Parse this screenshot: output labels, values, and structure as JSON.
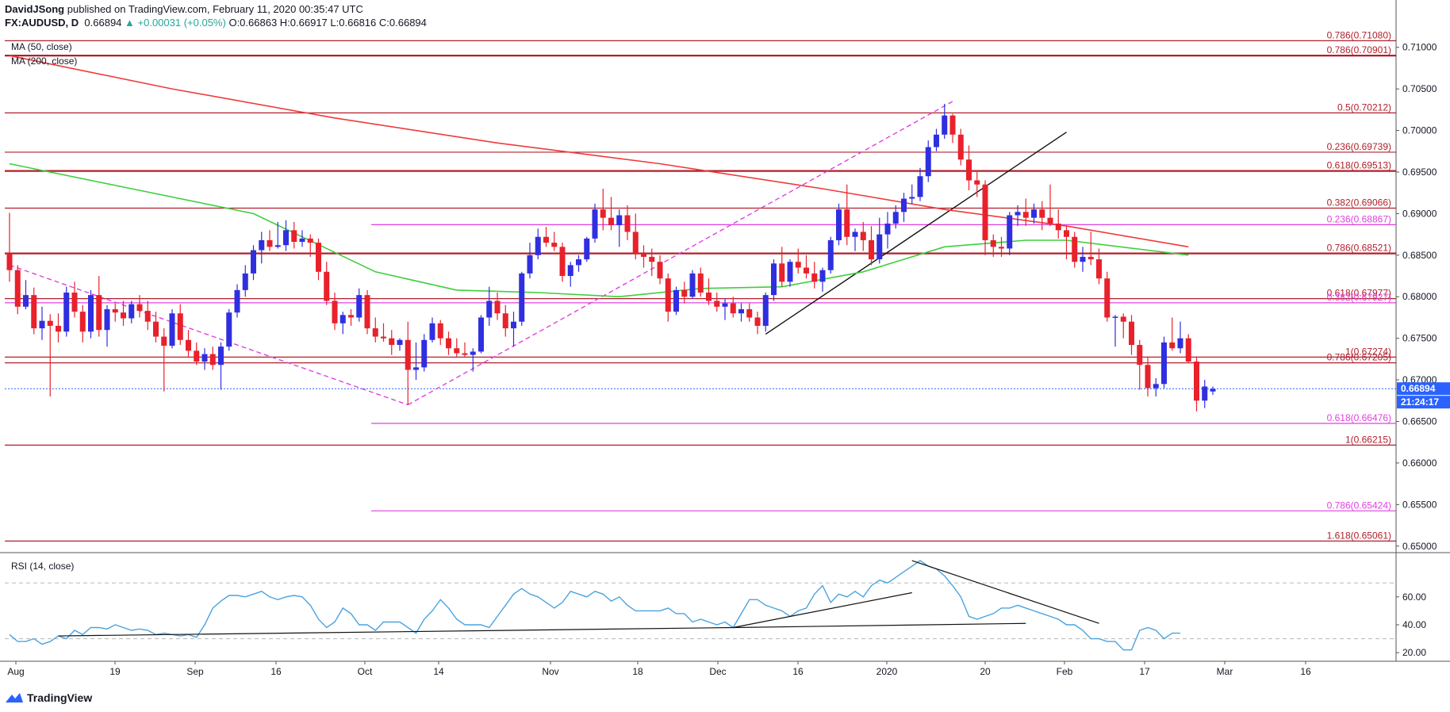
{
  "header": {
    "author": "DavidJSong",
    "published": "published on TradingView.com, February 11, 2020 00:35:47 UTC",
    "symbol": "FX:AUDUSD, D",
    "last": "0.66894",
    "change": "▲ +0.00031 (+0.05%)",
    "open": "O:0.66863",
    "high": "H:0.66917",
    "low": "L:0.66816",
    "close": "C:0.66894"
  },
  "footer": {
    "brand": "TradingView"
  },
  "colors": {
    "up": "#2f2fe0",
    "down": "#e8212b",
    "ma50": "#3ecf3e",
    "ma200": "#ef3b3b",
    "fib_red": "#b0202c",
    "fib_magenta": "#e040e0",
    "rsi": "#4aa3e0",
    "trend": "#111111",
    "axis_text": "#131722",
    "price_label": "#2962ff",
    "grid": "#b8b8b8"
  },
  "chart_data": {
    "type": "candlestick",
    "symbol": "FX:AUDUSD",
    "timeframe": "D",
    "legend": [
      "MA (50, close)",
      "MA (200, close)"
    ],
    "ylim": [
      0.6495,
      0.7115
    ],
    "y_ticks": [
      "0.71000",
      "0.70500",
      "0.70000",
      "0.69500",
      "0.69000",
      "0.68500",
      "0.68000",
      "0.67500",
      "0.67000",
      "0.66500",
      "0.66000",
      "0.65500",
      "0.65000"
    ],
    "x_ticks": [
      "Aug",
      "19",
      "Sep",
      "16",
      "Oct",
      "14",
      "Nov",
      "18",
      "Dec",
      "16",
      "2020",
      "20",
      "Feb",
      "17",
      "Mar",
      "16"
    ],
    "last_price": {
      "label": "0.66894",
      "value": 0.66894,
      "countdown": "21:24:17"
    },
    "fib_levels": [
      {
        "label": "0.786(0.71080)",
        "value": 0.7108,
        "color": "red"
      },
      {
        "label": "0.786(0.70901)",
        "value": 0.70901,
        "color": "red",
        "thick": true
      },
      {
        "label": "0.5(0.70212)",
        "value": 0.70212,
        "color": "red"
      },
      {
        "label": "0.236(0.69739)",
        "value": 0.69739,
        "color": "red"
      },
      {
        "label": "0.618(0.69513)",
        "value": 0.69513,
        "color": "red",
        "thick": true
      },
      {
        "label": "0.382(0.69066)",
        "value": 0.69066,
        "color": "red"
      },
      {
        "label": "0.236(0.68867)",
        "value": 0.68867,
        "color": "magenta",
        "from": "Oct"
      },
      {
        "label": "0.786(0.68521)",
        "value": 0.68521,
        "color": "red",
        "thick": true
      },
      {
        "label": "0.618(0.67977)",
        "value": 0.67977,
        "color": "red"
      },
      {
        "label": "0.382(0.67927)",
        "value": 0.67927,
        "color": "magenta"
      },
      {
        "label": "1(0.67274)",
        "value": 0.67274,
        "color": "red"
      },
      {
        "label": "0.786(0.67205)",
        "value": 0.67205,
        "color": "red"
      },
      {
        "label": "0.618(0.66476)",
        "value": 0.66476,
        "color": "magenta",
        "from": "Oct"
      },
      {
        "label": "1(0.66215)",
        "value": 0.66215,
        "color": "red"
      },
      {
        "label": "0.786(0.65424)",
        "value": 0.65424,
        "color": "magenta",
        "from": "Oct"
      },
      {
        "label": "1.618(0.65061)",
        "value": 0.65061,
        "color": "red"
      }
    ],
    "candles_ohlc": [
      [
        0.6852,
        0.6901,
        0.6818,
        0.6832
      ],
      [
        0.6832,
        0.6838,
        0.6779,
        0.6788
      ],
      [
        0.6788,
        0.682,
        0.6785,
        0.6802
      ],
      [
        0.6802,
        0.6811,
        0.6755,
        0.6762
      ],
      [
        0.6762,
        0.6788,
        0.6748,
        0.6771
      ],
      [
        0.6771,
        0.6779,
        0.668,
        0.6765
      ],
      [
        0.6765,
        0.678,
        0.6745,
        0.6758
      ],
      [
        0.6758,
        0.6812,
        0.6752,
        0.6805
      ],
      [
        0.6805,
        0.6818,
        0.6775,
        0.6782
      ],
      [
        0.6782,
        0.679,
        0.6745,
        0.6758
      ],
      [
        0.6758,
        0.6808,
        0.675,
        0.6802
      ],
      [
        0.6802,
        0.6825,
        0.6752,
        0.676
      ],
      [
        0.676,
        0.679,
        0.674,
        0.6785
      ],
      [
        0.6785,
        0.6792,
        0.677,
        0.6781
      ],
      [
        0.6781,
        0.6795,
        0.6765,
        0.6774
      ],
      [
        0.6774,
        0.6795,
        0.6768,
        0.6791
      ],
      [
        0.6791,
        0.6802,
        0.6775,
        0.6783
      ],
      [
        0.6783,
        0.6795,
        0.676,
        0.677
      ],
      [
        0.677,
        0.6782,
        0.6745,
        0.6752
      ],
      [
        0.6752,
        0.6762,
        0.6686,
        0.6741
      ],
      [
        0.6741,
        0.6785,
        0.6738,
        0.678
      ],
      [
        0.678,
        0.6791,
        0.6742,
        0.6748
      ],
      [
        0.6748,
        0.676,
        0.6728,
        0.6735
      ],
      [
        0.6735,
        0.6745,
        0.6718,
        0.6722
      ],
      [
        0.6722,
        0.6738,
        0.6712,
        0.6731
      ],
      [
        0.6731,
        0.674,
        0.6712,
        0.6718
      ],
      [
        0.6718,
        0.6745,
        0.6688,
        0.674
      ],
      [
        0.674,
        0.6785,
        0.6735,
        0.6781
      ],
      [
        0.6781,
        0.6815,
        0.6775,
        0.6808
      ],
      [
        0.6808,
        0.6838,
        0.68,
        0.6828
      ],
      [
        0.6828,
        0.6862,
        0.682,
        0.6856
      ],
      [
        0.6856,
        0.6878,
        0.684,
        0.6868
      ],
      [
        0.6868,
        0.688,
        0.6855,
        0.686
      ],
      [
        0.686,
        0.689,
        0.6858,
        0.6862
      ],
      [
        0.6862,
        0.6892,
        0.6855,
        0.688
      ],
      [
        0.688,
        0.689,
        0.6858,
        0.6866
      ],
      [
        0.6866,
        0.688,
        0.686,
        0.687
      ],
      [
        0.687,
        0.6875,
        0.6848,
        0.6865
      ],
      [
        0.6865,
        0.687,
        0.682,
        0.683
      ],
      [
        0.683,
        0.6842,
        0.679,
        0.6795
      ],
      [
        0.6795,
        0.6805,
        0.676,
        0.6768
      ],
      [
        0.6768,
        0.6782,
        0.6755,
        0.6778
      ],
      [
        0.6778,
        0.6785,
        0.6765,
        0.6775
      ],
      [
        0.6775,
        0.681,
        0.677,
        0.6802
      ],
      [
        0.6802,
        0.6808,
        0.6755,
        0.6762
      ],
      [
        0.6762,
        0.6775,
        0.6745,
        0.6752
      ],
      [
        0.6752,
        0.6768,
        0.6746,
        0.675
      ],
      [
        0.675,
        0.676,
        0.673,
        0.6742
      ],
      [
        0.6742,
        0.675,
        0.6735,
        0.6748
      ],
      [
        0.6748,
        0.677,
        0.667,
        0.6712
      ],
      [
        0.6712,
        0.6745,
        0.67,
        0.6715
      ],
      [
        0.6715,
        0.6755,
        0.671,
        0.6748
      ],
      [
        0.6748,
        0.6775,
        0.6745,
        0.6768
      ],
      [
        0.6768,
        0.6772,
        0.6742,
        0.675
      ],
      [
        0.675,
        0.6758,
        0.673,
        0.6738
      ],
      [
        0.6738,
        0.675,
        0.6728,
        0.6732
      ],
      [
        0.6732,
        0.6745,
        0.6728,
        0.673
      ],
      [
        0.673,
        0.6738,
        0.671,
        0.6734
      ],
      [
        0.6734,
        0.6778,
        0.6732,
        0.6775
      ],
      [
        0.6775,
        0.6812,
        0.6765,
        0.6795
      ],
      [
        0.6795,
        0.6805,
        0.6772,
        0.678
      ],
      [
        0.678,
        0.679,
        0.6752,
        0.6762
      ],
      [
        0.6762,
        0.6782,
        0.674,
        0.677
      ],
      [
        0.677,
        0.683,
        0.6765,
        0.6828
      ],
      [
        0.6828,
        0.6865,
        0.6822,
        0.685
      ],
      [
        0.685,
        0.6882,
        0.6845,
        0.6872
      ],
      [
        0.6872,
        0.6884,
        0.686,
        0.6865
      ],
      [
        0.6865,
        0.6878,
        0.6855,
        0.686
      ],
      [
        0.686,
        0.6865,
        0.6818,
        0.6825
      ],
      [
        0.6825,
        0.6842,
        0.6812,
        0.6838
      ],
      [
        0.6838,
        0.685,
        0.683,
        0.6845
      ],
      [
        0.6845,
        0.6872,
        0.6842,
        0.687
      ],
      [
        0.687,
        0.6912,
        0.6865,
        0.6905
      ],
      [
        0.6905,
        0.693,
        0.688,
        0.6895
      ],
      [
        0.6895,
        0.692,
        0.688,
        0.6886
      ],
      [
        0.6886,
        0.6905,
        0.686,
        0.6898
      ],
      [
        0.6898,
        0.691,
        0.6868,
        0.6878
      ],
      [
        0.6878,
        0.69,
        0.6845,
        0.6852
      ],
      [
        0.6852,
        0.6862,
        0.6835,
        0.6848
      ],
      [
        0.6848,
        0.6858,
        0.6825,
        0.6842
      ],
      [
        0.6842,
        0.685,
        0.6815,
        0.6822
      ],
      [
        0.6822,
        0.6828,
        0.677,
        0.6782
      ],
      [
        0.6782,
        0.6812,
        0.6778,
        0.6808
      ],
      [
        0.6808,
        0.6818,
        0.6792,
        0.68
      ],
      [
        0.68,
        0.6832,
        0.6798,
        0.6828
      ],
      [
        0.6828,
        0.6835,
        0.68,
        0.6805
      ],
      [
        0.6805,
        0.6822,
        0.679,
        0.6795
      ],
      [
        0.6795,
        0.6805,
        0.6782,
        0.6788
      ],
      [
        0.6788,
        0.6798,
        0.6772,
        0.6792
      ],
      [
        0.6792,
        0.68,
        0.6775,
        0.678
      ],
      [
        0.678,
        0.6792,
        0.677,
        0.6785
      ],
      [
        0.6785,
        0.6792,
        0.677,
        0.6775
      ],
      [
        0.6775,
        0.6782,
        0.6755,
        0.6765
      ],
      [
        0.6765,
        0.6805,
        0.6758,
        0.6802
      ],
      [
        0.6802,
        0.6845,
        0.6795,
        0.684
      ],
      [
        0.684,
        0.686,
        0.6812,
        0.6818
      ],
      [
        0.6818,
        0.6845,
        0.6812,
        0.6842
      ],
      [
        0.6842,
        0.6858,
        0.6828,
        0.6835
      ],
      [
        0.6835,
        0.685,
        0.6822,
        0.6828
      ],
      [
        0.6828,
        0.6842,
        0.681,
        0.6818
      ],
      [
        0.6818,
        0.6835,
        0.6806,
        0.6832
      ],
      [
        0.6832,
        0.6872,
        0.6828,
        0.6868
      ],
      [
        0.6868,
        0.6912,
        0.6862,
        0.6905
      ],
      [
        0.6905,
        0.6935,
        0.6862,
        0.6872
      ],
      [
        0.6872,
        0.6882,
        0.6855,
        0.6878
      ],
      [
        0.6878,
        0.689,
        0.6855,
        0.6868
      ],
      [
        0.6868,
        0.6885,
        0.6838,
        0.6845
      ],
      [
        0.6845,
        0.6895,
        0.684,
        0.6875
      ],
      [
        0.6875,
        0.6902,
        0.6858,
        0.6888
      ],
      [
        0.6888,
        0.691,
        0.6882,
        0.6902
      ],
      [
        0.6902,
        0.6925,
        0.689,
        0.6918
      ],
      [
        0.6918,
        0.6935,
        0.6912,
        0.692
      ],
      [
        0.692,
        0.6955,
        0.6915,
        0.6945
      ],
      [
        0.6945,
        0.6988,
        0.6938,
        0.698
      ],
      [
        0.698,
        0.7002,
        0.6975,
        0.6995
      ],
      [
        0.6995,
        0.7032,
        0.699,
        0.7018
      ],
      [
        0.7018,
        0.702,
        0.6985,
        0.6995
      ],
      [
        0.6995,
        0.7002,
        0.6958,
        0.6965
      ],
      [
        0.6965,
        0.6982,
        0.6928,
        0.694
      ],
      [
        0.694,
        0.695,
        0.692,
        0.6935
      ],
      [
        0.6935,
        0.694,
        0.685,
        0.6868
      ],
      [
        0.6868,
        0.6875,
        0.6848,
        0.686
      ],
      [
        0.686,
        0.6872,
        0.6848,
        0.6858
      ],
      [
        0.6858,
        0.6902,
        0.685,
        0.6898
      ],
      [
        0.6898,
        0.691,
        0.6885,
        0.6902
      ],
      [
        0.6902,
        0.6918,
        0.6885,
        0.6895
      ],
      [
        0.6895,
        0.6912,
        0.6888,
        0.6905
      ],
      [
        0.6905,
        0.6915,
        0.688,
        0.6895
      ],
      [
        0.6895,
        0.6935,
        0.6885,
        0.6888
      ],
      [
        0.6888,
        0.6905,
        0.687,
        0.688
      ],
      [
        0.688,
        0.6885,
        0.6845,
        0.6872
      ],
      [
        0.6872,
        0.6878,
        0.6835,
        0.6842
      ],
      [
        0.6842,
        0.686,
        0.683,
        0.6848
      ],
      [
        0.6848,
        0.6878,
        0.6838,
        0.6845
      ],
      [
        0.6845,
        0.6858,
        0.6815,
        0.6822
      ],
      [
        0.6822,
        0.683,
        0.677,
        0.6775
      ],
      [
        0.6775,
        0.6778,
        0.674,
        0.6776
      ],
      [
        0.6776,
        0.678,
        0.675,
        0.677
      ],
      [
        0.677,
        0.6778,
        0.673,
        0.6742
      ],
      [
        0.6742,
        0.6748,
        0.6688,
        0.6718
      ],
      [
        0.6718,
        0.6728,
        0.668,
        0.669
      ],
      [
        0.669,
        0.6702,
        0.668,
        0.6695
      ],
      [
        0.6695,
        0.6752,
        0.669,
        0.6745
      ],
      [
        0.6745,
        0.6775,
        0.6735,
        0.6738
      ],
      [
        0.6738,
        0.677,
        0.6732,
        0.675
      ],
      [
        0.675,
        0.6755,
        0.672,
        0.6722
      ],
      [
        0.6722,
        0.6728,
        0.6662,
        0.6675
      ],
      [
        0.6675,
        0.67,
        0.6666,
        0.6692
      ],
      [
        0.6686,
        0.6692,
        0.6682,
        0.6689
      ]
    ],
    "ma50": [
      [
        0,
        0.696
      ],
      [
        15,
        0.693
      ],
      [
        30,
        0.69
      ],
      [
        45,
        0.683
      ],
      [
        55,
        0.6808
      ],
      [
        65,
        0.6805
      ],
      [
        75,
        0.68
      ],
      [
        85,
        0.681
      ],
      [
        95,
        0.6812
      ],
      [
        105,
        0.683
      ],
      [
        115,
        0.686
      ],
      [
        125,
        0.6868
      ],
      [
        130,
        0.6868
      ],
      [
        140,
        0.6856
      ],
      [
        145,
        0.685
      ]
    ],
    "ma200": [
      [
        0,
        0.709
      ],
      [
        20,
        0.705
      ],
      [
        40,
        0.7015
      ],
      [
        60,
        0.6985
      ],
      [
        80,
        0.696
      ],
      [
        100,
        0.693
      ],
      [
        115,
        0.6905
      ],
      [
        130,
        0.6885
      ],
      [
        145,
        0.686
      ]
    ],
    "rsi": {
      "label": "RSI (14, close)",
      "ylim": [
        15,
        90
      ],
      "y_ticks": [
        "60.00",
        "40.00",
        "20.00"
      ],
      "bands": [
        70,
        30
      ],
      "values": [
        33,
        28,
        28,
        30,
        26,
        28,
        32,
        30,
        36,
        33,
        38,
        38,
        37,
        40,
        38,
        36,
        37,
        36,
        33,
        34,
        33,
        32,
        33,
        31,
        40,
        52,
        57,
        61,
        61,
        60,
        62,
        64,
        60,
        58,
        60,
        61,
        60,
        54,
        44,
        38,
        42,
        52,
        48,
        40,
        40,
        36,
        42,
        42,
        42,
        38,
        34,
        44,
        50,
        58,
        52,
        44,
        40,
        40,
        40,
        38,
        46,
        54,
        62,
        66,
        62,
        60,
        56,
        52,
        56,
        64,
        62,
        60,
        64,
        62,
        57,
        60,
        54,
        50,
        50,
        50,
        50,
        52,
        48,
        48,
        42,
        44,
        42,
        40,
        42,
        38,
        48,
        58,
        58,
        54,
        52,
        50,
        46,
        50,
        52,
        62,
        68,
        56,
        62,
        60,
        64,
        60,
        68,
        72,
        70,
        74,
        78,
        82,
        86,
        82,
        80,
        75,
        68,
        60,
        46,
        44,
        46,
        48,
        52,
        52,
        54,
        52,
        50,
        48,
        46,
        44,
        40,
        40,
        36,
        30,
        30,
        28,
        28,
        22,
        22,
        36,
        38,
        36,
        30,
        34,
        34
      ]
    },
    "trend_lines": [
      {
        "kind": "dashed-magenta",
        "from": [
          0,
          0.6838
        ],
        "to": [
          49,
          0.667
        ]
      },
      {
        "kind": "dashed-magenta",
        "from": [
          49,
          0.667
        ],
        "to": [
          116,
          0.7035
        ]
      },
      {
        "kind": "solid-black",
        "from": [
          93,
          0.6755
        ],
        "to": [
          130,
          0.6998
        ]
      }
    ]
  }
}
